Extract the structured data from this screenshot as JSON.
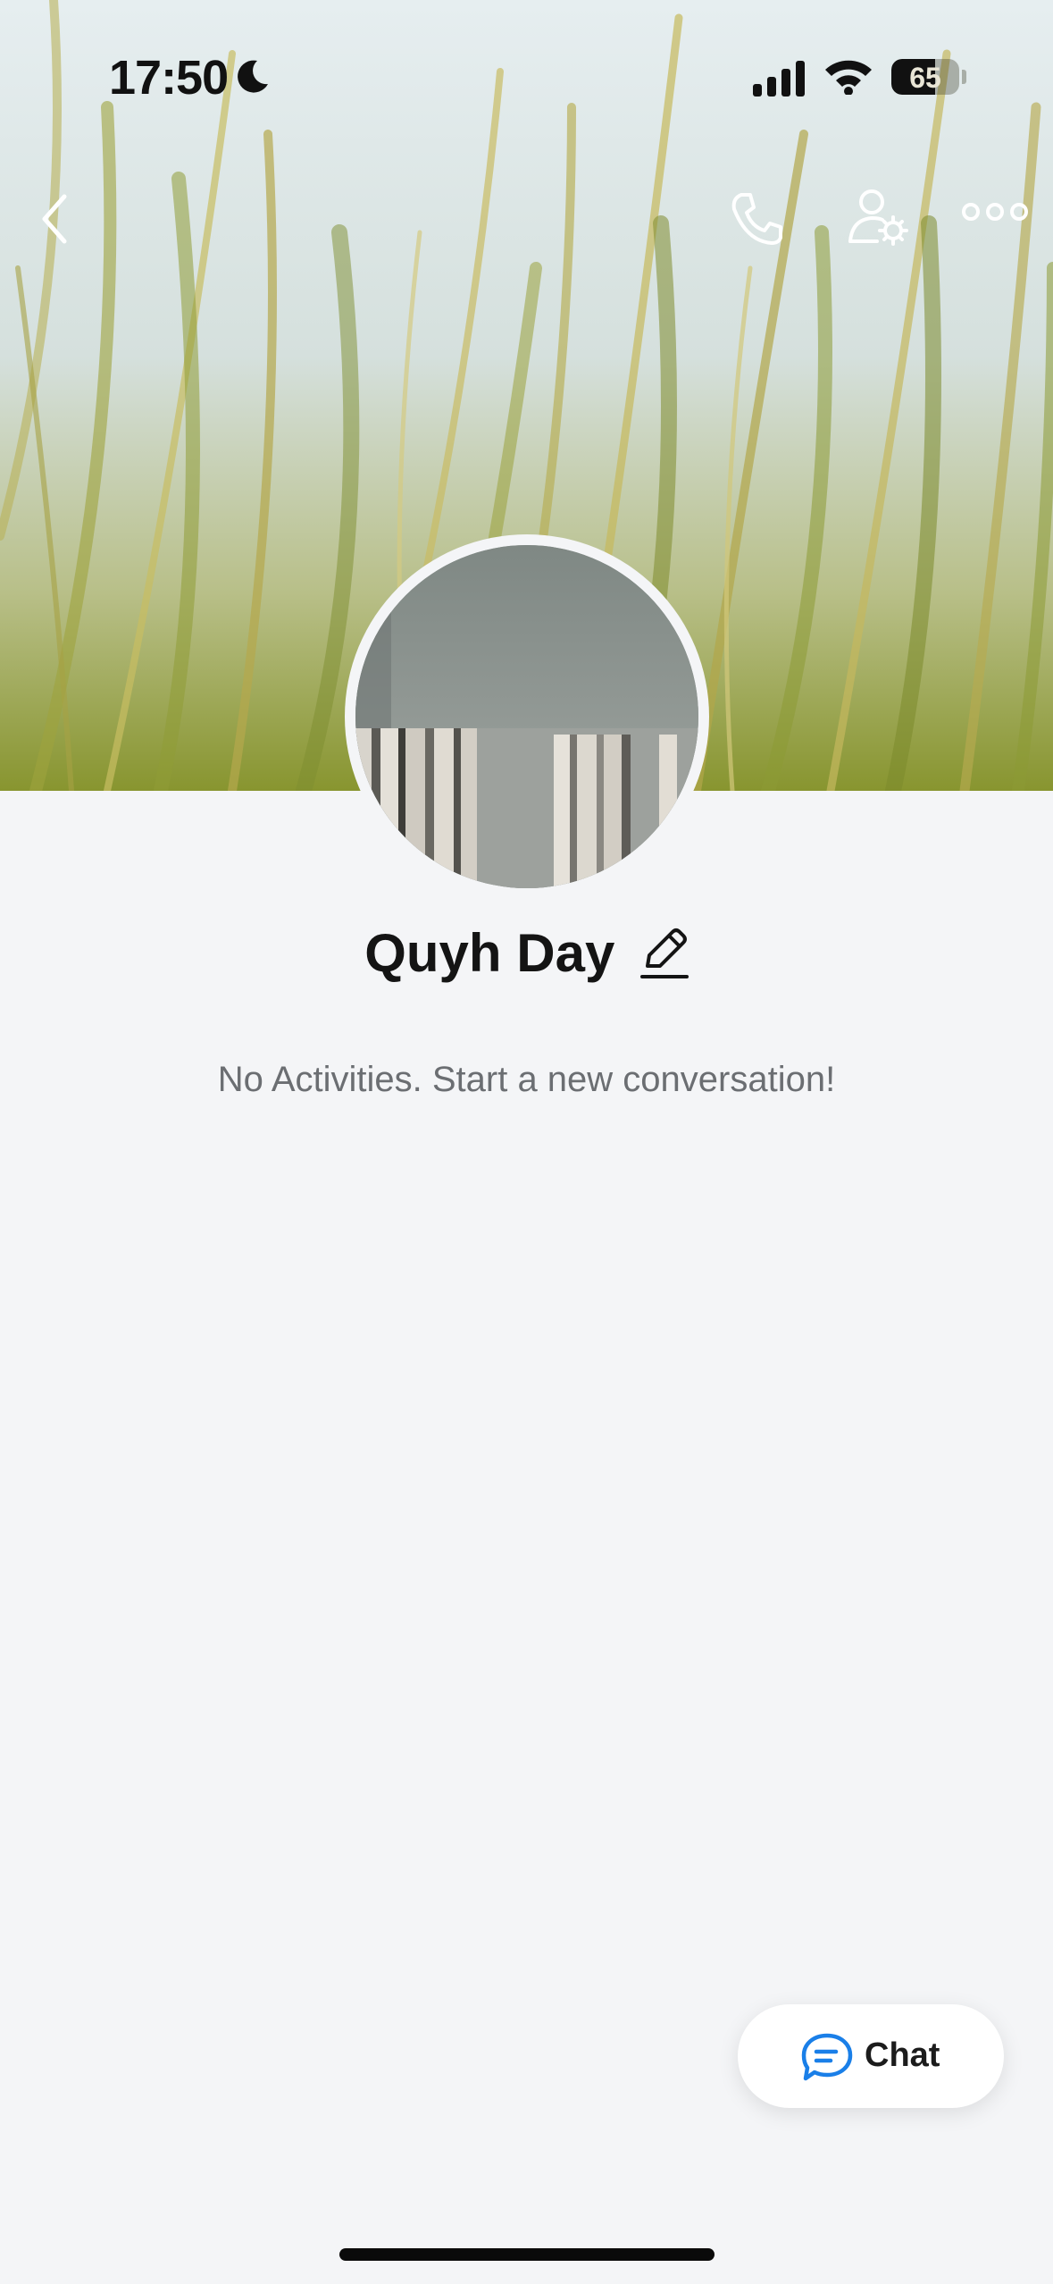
{
  "status_bar": {
    "time": "17:50",
    "battery_level": "65",
    "battery_fraction": 0.65
  },
  "nav": {
    "icons": [
      "back-icon",
      "phone-icon",
      "user-settings-icon",
      "more-icon"
    ]
  },
  "profile": {
    "name": "Quyh Day",
    "empty_state": "No Activities. Start a new conversation!"
  },
  "chat_button": {
    "label": "Chat",
    "icon": "chat-bubble-icon",
    "icon_color": "#1a7fe8"
  },
  "colors": {
    "background": "#f4f5f7",
    "accent": "#1a7fe8"
  }
}
